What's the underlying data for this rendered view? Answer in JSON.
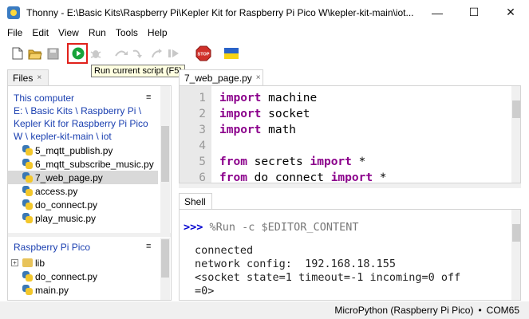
{
  "window": {
    "app_name": "Thonny",
    "path": "E:\\Basic Kits\\Raspberry Pi\\Kepler Kit for Raspberry Pi Pico W\\kepler-kit-main\\iot...",
    "minimize": "—",
    "maximize": "☐",
    "close": "✕"
  },
  "menu": [
    "File",
    "Edit",
    "View",
    "Run",
    "Tools",
    "Help"
  ],
  "toolbar": {
    "tooltip": "Run current script (F5)",
    "stop_label": "STOP",
    "accent_run": "#17a33a",
    "accent_stop": "#d0302a",
    "icons": [
      "new-file-icon",
      "open-folder-icon",
      "save-icon",
      "run-icon",
      "debug-icon",
      "step-over-icon",
      "step-into-icon",
      "step-out-icon",
      "resume-icon",
      "stop-icon",
      "ukraine-flag-icon"
    ]
  },
  "files": {
    "tab_label": "Files",
    "close": "×",
    "computer": {
      "title": "This computer",
      "breadcrumb": [
        "E:",
        "Basic Kits",
        "Raspberry Pi",
        "Kepler Kit for Raspberry Pi Pico W",
        "kepler-kit-main",
        "iot"
      ],
      "items": [
        {
          "name": "5_mqtt_publish.py",
          "selected": false
        },
        {
          "name": "6_mqtt_subscribe_music.py",
          "selected": false
        },
        {
          "name": "7_web_page.py",
          "selected": true
        },
        {
          "name": "access.py",
          "selected": false
        },
        {
          "name": "do_connect.py",
          "selected": false
        },
        {
          "name": "play_music.py",
          "selected": false
        }
      ]
    },
    "device": {
      "title": "Raspberry Pi Pico",
      "items": [
        {
          "name": "lib",
          "type": "folder"
        },
        {
          "name": "do_connect.py",
          "type": "file"
        },
        {
          "name": "main.py",
          "type": "file"
        }
      ]
    },
    "menu_glyph": "≡"
  },
  "editor": {
    "tab_label": "7_web_page.py",
    "close": "×",
    "lines": [
      {
        "n": "1",
        "kw": "import",
        "rest": " machine",
        "tail": "",
        "tail2": ""
      },
      {
        "n": "2",
        "kw": "import",
        "rest": " socket",
        "tail": "",
        "tail2": ""
      },
      {
        "n": "3",
        "kw": "import",
        "rest": " math",
        "tail": "",
        "tail2": ""
      },
      {
        "n": "4",
        "kw": "",
        "rest": "",
        "tail": "",
        "tail2": ""
      },
      {
        "n": "5",
        "kw": "from",
        "rest": " secrets ",
        "tail": "import",
        "tail2": " *"
      },
      {
        "n": "6",
        "kw": "from",
        "rest": " do_connect ",
        "tail": "import",
        "tail2": " *"
      }
    ]
  },
  "shell": {
    "tab_label": "Shell",
    "prompt": ">>>",
    "command": " %Run -c $EDITOR_CONTENT",
    "output": [
      "connected",
      "network config:  192.168.18.155",
      "<socket state=1 timeout=-1 incoming=0 off",
      "=0>"
    ]
  },
  "status": {
    "interpreter": "MicroPython (Raspberry Pi Pico)",
    "separator": "•",
    "port": "COM65"
  }
}
